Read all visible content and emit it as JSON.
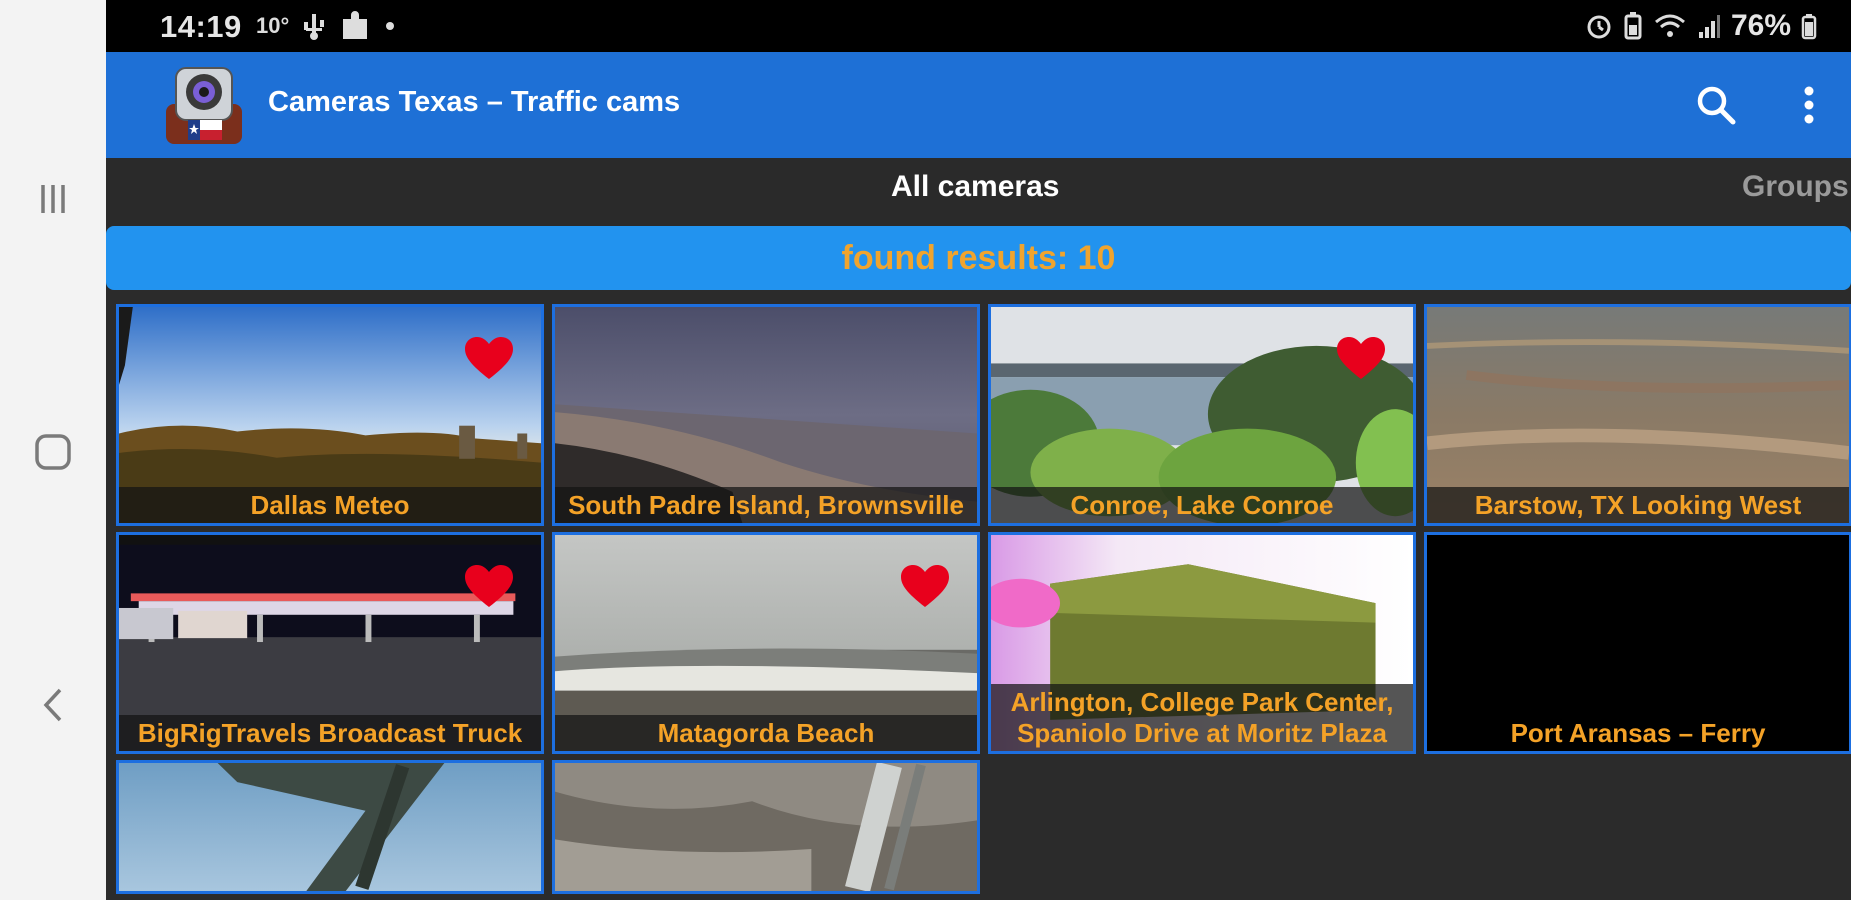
{
  "status_bar": {
    "time": "14:19",
    "temperature": "10°",
    "battery": "76%"
  },
  "app_bar": {
    "title": "Cameras Texas – Traffic cams",
    "icons": [
      "camera-logo-icon",
      "search-icon",
      "more-vert-icon"
    ]
  },
  "tabs": [
    {
      "label": "All cameras",
      "active": true
    },
    {
      "label": "Groups",
      "active": false
    }
  ],
  "results": {
    "text": "found results: 10"
  },
  "cameras": [
    {
      "label": "Dallas Meteo",
      "favorite": true
    },
    {
      "label": "South Padre Island, Brownsville",
      "favorite": false
    },
    {
      "label": "Conroe, Lake Conroe",
      "favorite": true
    },
    {
      "label": "Barstow, TX Looking West",
      "favorite": false
    },
    {
      "label": "BigRigTravels Broadcast Truck",
      "favorite": true
    },
    {
      "label": "Matagorda Beach",
      "favorite": true
    },
    {
      "label": "Arlington, College Park Center, Spaniolo Drive at Moritz Plaza",
      "favorite": false
    },
    {
      "label": "Port Aransas – Ferry",
      "favorite": false
    },
    {
      "label": "",
      "favorite": false
    },
    {
      "label": "",
      "favorite": false
    }
  ],
  "colors": {
    "app_bar": "#1e70d6",
    "results_bar": "#2293ef",
    "label_text": "#f4a227",
    "tile_border": "#1d6fe0",
    "heart": "#e8001c"
  }
}
